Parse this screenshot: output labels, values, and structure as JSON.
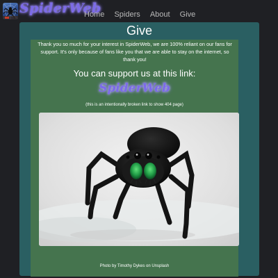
{
  "header": {
    "logo_text": "SpiderWeb",
    "logo_icon": "spider-on-web-icon"
  },
  "nav": {
    "items": [
      {
        "label": "Home"
      },
      {
        "label": "Spiders"
      },
      {
        "label": "About"
      },
      {
        "label": "Give"
      }
    ]
  },
  "main": {
    "title": "Give",
    "intro": "Thank you so much for your interest in SpiderWeb, we are 100% reliant on our fans for support. It's only because of fans like you that we are able to stay on the internet, so thank you!",
    "support_heading": "You can support us at this link:",
    "support_link_text": "SpiderWeb",
    "broken_note": "(this is an intentionally broken link to show 404 page)",
    "photo": {
      "subject": "jumping-spider-photo",
      "caption": "Photo by Timothy Dykes on Unsplash"
    }
  },
  "colors": {
    "page_background": "#1f2024",
    "panel": "#2a5f62",
    "card": "#45744e",
    "logo_accent": "#7c6be8",
    "nav_text": "#b9b9b9"
  }
}
